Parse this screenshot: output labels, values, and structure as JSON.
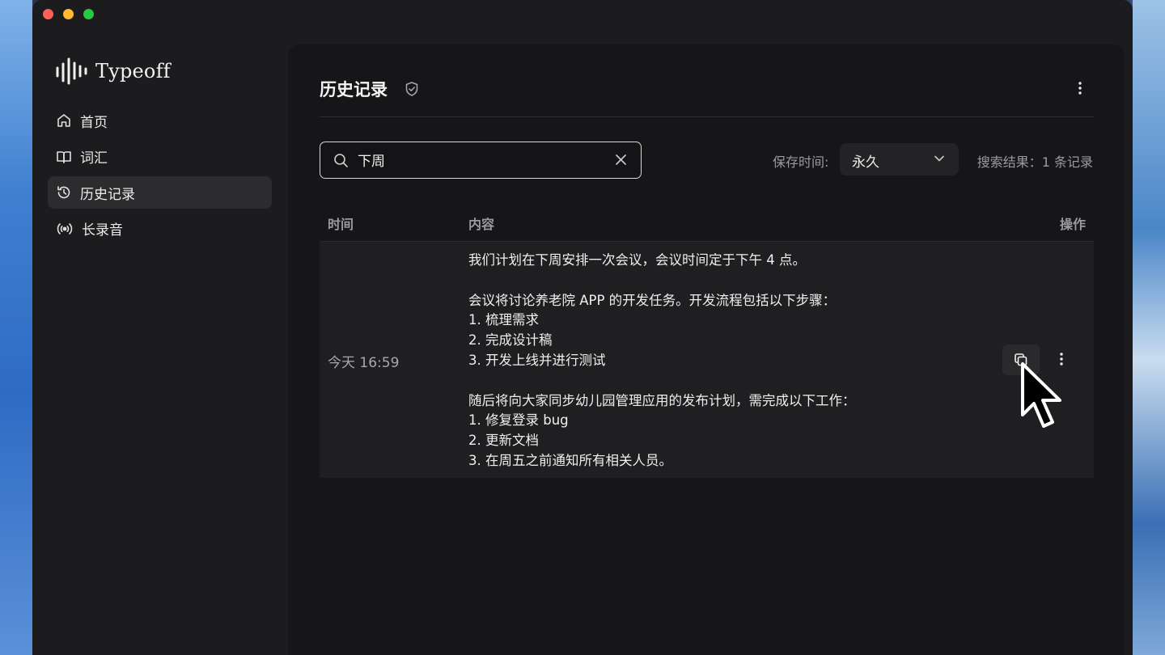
{
  "app": {
    "name": "Typeoff"
  },
  "sidebar": {
    "items": [
      {
        "label": "首页",
        "icon": "home-icon",
        "active": false
      },
      {
        "label": "词汇",
        "icon": "book-icon",
        "active": false
      },
      {
        "label": "历史记录",
        "icon": "history-icon",
        "active": true
      },
      {
        "label": "长录音",
        "icon": "broadcast-icon",
        "active": false
      }
    ]
  },
  "header": {
    "title": "历史记录"
  },
  "search": {
    "value": "下周"
  },
  "retention": {
    "label": "保存时间:",
    "value": "永久"
  },
  "results": {
    "text": "搜索结果：1 条记录"
  },
  "table": {
    "columns": {
      "time": "时间",
      "content": "内容",
      "action": "操作"
    },
    "rows": [
      {
        "time": "今天 16:59",
        "content": "我们计划在下周安排一次会议，会议时间定于下午 4 点。\n\n会议将讨论养老院 APP 的开发任务。开发流程包括以下步骤：\n1. 梳理需求\n2. 完成设计稿\n3. 开发上线并进行测试\n\n随后将向大家同步幼儿园管理应用的发布计划，需完成以下工作：\n1. 修复登录 bug\n2. 更新文档\n3. 在周五之前通知所有相关人员。"
      }
    ]
  },
  "colors": {
    "accent_border": "#d8d8d8",
    "active_nav": "#2c2c2e",
    "window_bg": "#1c1c1e",
    "panel_bg": "#161618"
  }
}
